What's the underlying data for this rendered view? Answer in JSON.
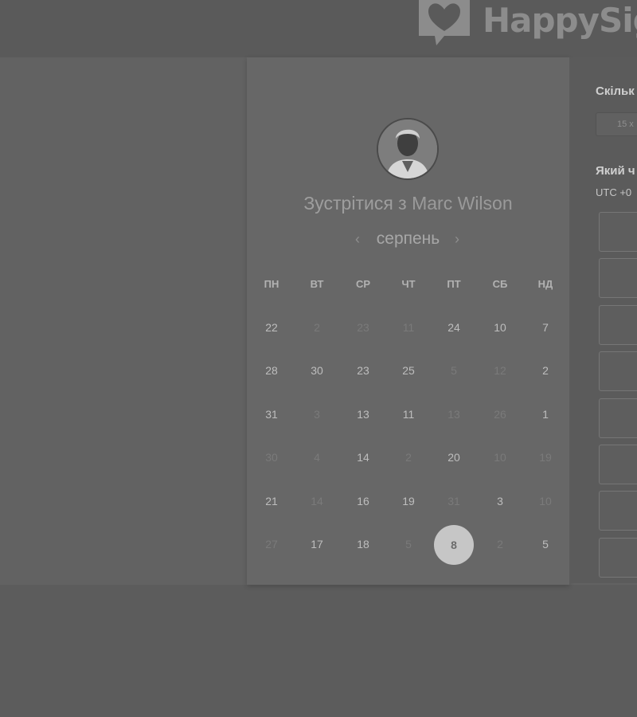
{
  "brand": {
    "name": "HappySig"
  },
  "booking": {
    "title_prefix": "Зустрітися з",
    "host_name": "Marc Wilson",
    "month": "серпень",
    "prev_arrow": "‹",
    "next_arrow": "›"
  },
  "calendar": {
    "weekdays": [
      "ПН",
      "ВТ",
      "СР",
      "ЧТ",
      "ПТ",
      "СБ",
      "НД"
    ],
    "selected_day": "8",
    "weeks": [
      [
        {
          "d": "22",
          "on": true
        },
        {
          "d": "2",
          "on": false
        },
        {
          "d": "23",
          "on": false
        },
        {
          "d": "11",
          "on": false
        },
        {
          "d": "24",
          "on": true
        },
        {
          "d": "10",
          "on": true
        },
        {
          "d": "7",
          "on": true
        }
      ],
      [
        {
          "d": "28",
          "on": true
        },
        {
          "d": "30",
          "on": true
        },
        {
          "d": "23",
          "on": true
        },
        {
          "d": "25",
          "on": true
        },
        {
          "d": "5",
          "on": false
        },
        {
          "d": "12",
          "on": false
        },
        {
          "d": "2",
          "on": true
        }
      ],
      [
        {
          "d": "31",
          "on": true
        },
        {
          "d": "3",
          "on": false
        },
        {
          "d": "13",
          "on": true
        },
        {
          "d": "11",
          "on": true
        },
        {
          "d": "13",
          "on": false
        },
        {
          "d": "26",
          "on": false
        },
        {
          "d": "1",
          "on": true
        }
      ],
      [
        {
          "d": "30",
          "on": false
        },
        {
          "d": "4",
          "on": false
        },
        {
          "d": "14",
          "on": true
        },
        {
          "d": "2",
          "on": false
        },
        {
          "d": "20",
          "on": true
        },
        {
          "d": "10",
          "on": false
        },
        {
          "d": "19",
          "on": false
        }
      ],
      [
        {
          "d": "21",
          "on": true
        },
        {
          "d": "14",
          "on": false
        },
        {
          "d": "16",
          "on": true
        },
        {
          "d": "19",
          "on": true
        },
        {
          "d": "31",
          "on": false
        },
        {
          "d": "3",
          "on": true
        },
        {
          "d": "10",
          "on": false
        }
      ],
      [
        {
          "d": "27",
          "on": false
        },
        {
          "d": "17",
          "on": true
        },
        {
          "d": "18",
          "on": true
        },
        {
          "d": "5",
          "on": false
        },
        {
          "d": "8",
          "on": true,
          "selected": true
        },
        {
          "d": "2",
          "on": false
        },
        {
          "d": "5",
          "on": true
        }
      ]
    ]
  },
  "right_panel": {
    "duration_question": "Скільк",
    "duration_value": "15 х",
    "time_question": "Який ч",
    "timezone": "UTC +0",
    "slot_count": 8
  },
  "colors": {
    "background": "#5c5c5c",
    "card": "#676767",
    "selected_day_bg": "#c6c6c6"
  }
}
